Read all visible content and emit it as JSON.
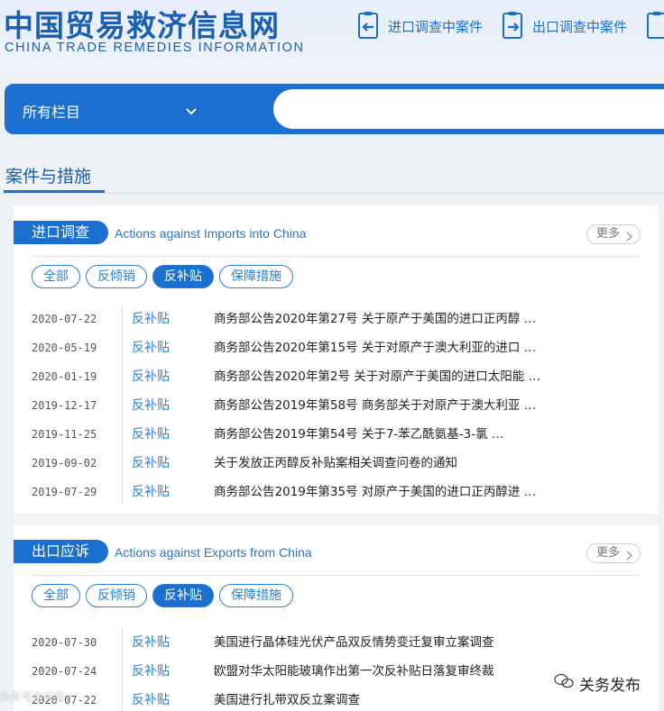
{
  "header": {
    "logo_cn": "中国贸易救济信息网",
    "logo_en": "CHINA TRADE REMEDIES INFORMATION",
    "links": [
      {
        "label": "进口调查中案件",
        "icon": "document-in-icon"
      },
      {
        "label": "出口调查中案件",
        "icon": "document-out-icon"
      }
    ]
  },
  "search": {
    "category": "所有栏目",
    "placeholder": ""
  },
  "section": {
    "title": "案件与措施"
  },
  "panels": [
    {
      "tag": "进口调查",
      "subtitle": "Actions against Imports into China",
      "more": "更多",
      "filters": [
        "全部",
        "反倾销",
        "反补贴",
        "保障措施"
      ],
      "active_filter": "反补贴",
      "rows": [
        {
          "date": "2020-07-22",
          "type": "反补贴",
          "title": "商务部公告2020年第27号  关于原产于美国的进口正丙醇  …"
        },
        {
          "date": "2020-05-19",
          "type": "反补贴",
          "title": "商务部公告2020年第15号  关于对原产于澳大利亚的进口  …"
        },
        {
          "date": "2020-01-19",
          "type": "反补贴",
          "title": "商务部公告2020年第2号  关于对原产于美国的进口太阳能  …"
        },
        {
          "date": "2019-12-17",
          "type": "反补贴",
          "title": "商务部公告2019年第58号  商务部关于对原产于澳大利亚  …"
        },
        {
          "date": "2019-11-25",
          "type": "反补贴",
          "title": "商务部公告2019年第54号  关于7-苯乙酰氨基-3-氯  …"
        },
        {
          "date": "2019-09-02",
          "type": "反补贴",
          "title": "关于发放正丙醇反补贴案相关调查问卷的通知"
        },
        {
          "date": "2019-07-29",
          "type": "反补贴",
          "title": "商务部公告2019年第35号  对原产于美国的进口正丙醇进  …"
        }
      ]
    },
    {
      "tag": "出口应诉",
      "subtitle": "Actions against Exports from China",
      "more": "更多",
      "filters": [
        "全部",
        "反倾销",
        "反补贴",
        "保障措施"
      ],
      "active_filter": "反补贴",
      "rows": [
        {
          "date": "2020-07-30",
          "type": "反补贴",
          "title": "美国进行晶体硅光伏产品双反情势变迁复审立案调查"
        },
        {
          "date": "2020-07-24",
          "type": "反补贴",
          "title": "欧盟对华太阳能玻璃作出第一次反补贴日落复审终裁"
        },
        {
          "date": "2020-07-22",
          "type": "反补贴",
          "title": "美国进行扎带双反立案调查"
        }
      ]
    }
  ],
  "watermark": {
    "left": "头条号@关务",
    "right": "关务发布"
  },
  "colors": {
    "brand_blue": "#1a6fd0",
    "link_blue": "#2a7fd4"
  }
}
